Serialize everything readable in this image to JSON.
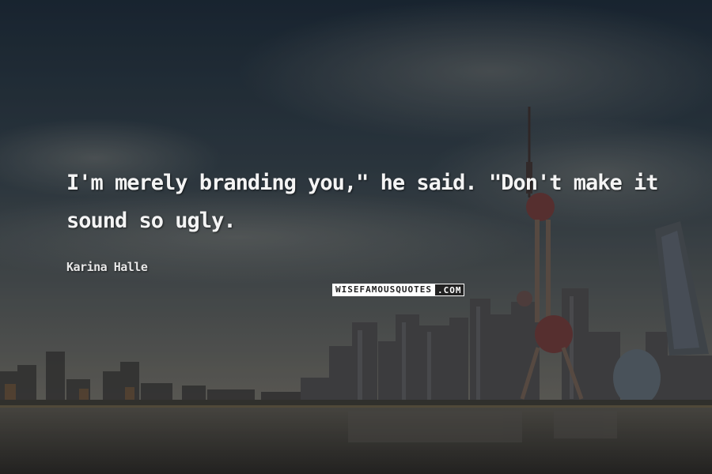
{
  "quote": {
    "text": "I'm merely branding you,\" he said. \"Don't make it sound so ugly."
  },
  "author": {
    "name": "Karina Halle"
  },
  "watermark": {
    "left": "WISEFAMOUSQUOTES",
    "right": ".COM"
  },
  "scene": {
    "subject": "city-skyline-at-dusk",
    "colors": {
      "sky": "#2a3742",
      "water": "#3a3a38",
      "haze": "#6b6c68"
    },
    "icons": [
      "tv-tower-icon",
      "skyscraper-icon"
    ]
  }
}
